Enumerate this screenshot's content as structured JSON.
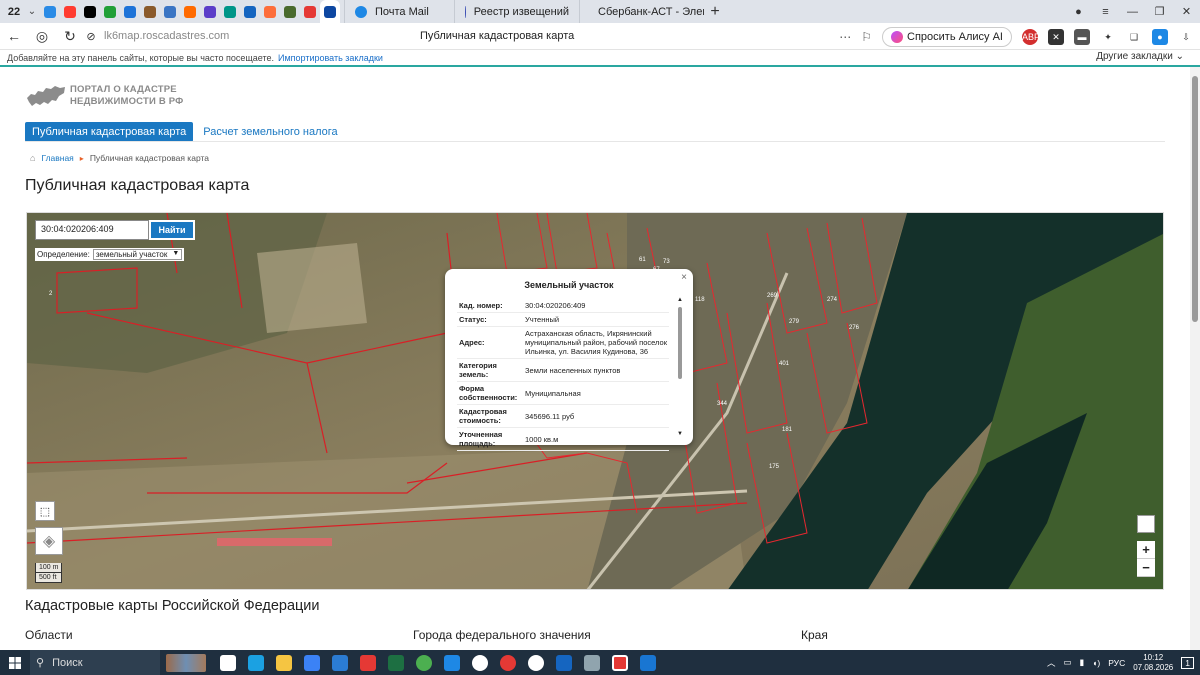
{
  "browser": {
    "tab_count": "22",
    "tabs": [
      {
        "label": "Почта Mail",
        "color": "#1e88e5"
      },
      {
        "label": "Реестр извещений",
        "color": "#3f51b5"
      },
      {
        "label": "Сбербанк-АСТ - Электро",
        "color": "#43a047"
      }
    ],
    "pinned_colors": [
      "#2a8be6",
      "#ff3b30",
      "#000000",
      "#21a038",
      "#1e73d8",
      "#8a5a2b",
      "#3a75c4",
      "#ff6a00",
      "#5b3ec9",
      "#009688",
      "#1565c0",
      "#fd6d3a",
      "#4a6b2e",
      "#e53935",
      "#0d47a1"
    ],
    "url": "lk6map.roscadastres.com",
    "page_title": "Публичная кадастровая карта",
    "alice_label": "Спросить Алису AI",
    "abp_label": "ABP",
    "bookmark_hint": "Добавляйте на эту панель сайты, которые вы часто посещаете.",
    "bookmark_import": "Импортировать закладки",
    "other_bookmarks": "Другие закладки"
  },
  "site": {
    "logo_line1": "ПОРТАЛ О КАДАСТРЕ",
    "logo_line2": "НЕДВИЖИМОСТИ В РФ",
    "menu": [
      "Публичная кадастровая карта",
      "Расчет земельного налога"
    ],
    "breadcrumb_home": "Главная",
    "breadcrumb_current": "Публичная кадастровая карта",
    "heading": "Публичная кадастровая карта",
    "section_heading": "Кадастровые карты Российской Федерации",
    "columns": [
      "Области",
      "Города федерального значения",
      "Края"
    ]
  },
  "map": {
    "search_value": "30:04:020206:409",
    "search_button": "Найти",
    "definition_label": "Определение:",
    "definition_value": "земельный участок",
    "scale_metric": "100 m",
    "scale_imperial": "500 ft",
    "zoom_in": "+",
    "zoom_out": "−",
    "popup": {
      "title": "Земельный участок",
      "close": "×",
      "rows": [
        {
          "key": "Кад. номер:",
          "value": "30:04:020206:409"
        },
        {
          "key": "Статус:",
          "value": "Учтенный"
        },
        {
          "key": "Адрес:",
          "value": "Астраханская область, Икрянинский муниципальный район, рабочий поселок Ильинка, ул. Василия Кудинова, 36"
        },
        {
          "key": "Категория земель:",
          "value": "Земли населенных пунктов"
        },
        {
          "key": "Форма собственности:",
          "value": "Муниципальная"
        },
        {
          "key": "Кадастровая стоимость:",
          "value": "345696.11 руб"
        },
        {
          "key": "Уточненная площадь:",
          "value": "1000 кв.м"
        }
      ]
    },
    "parcel_labels": [
      "2",
      "269",
      "274",
      "276",
      "279",
      "344",
      "181",
      "175",
      "61",
      "67",
      "73",
      "401",
      "118"
    ]
  },
  "taskbar": {
    "search_label": "Поиск",
    "lang": "РУС",
    "time": "10:12",
    "date": "07.08.2026",
    "notifications": "1"
  }
}
